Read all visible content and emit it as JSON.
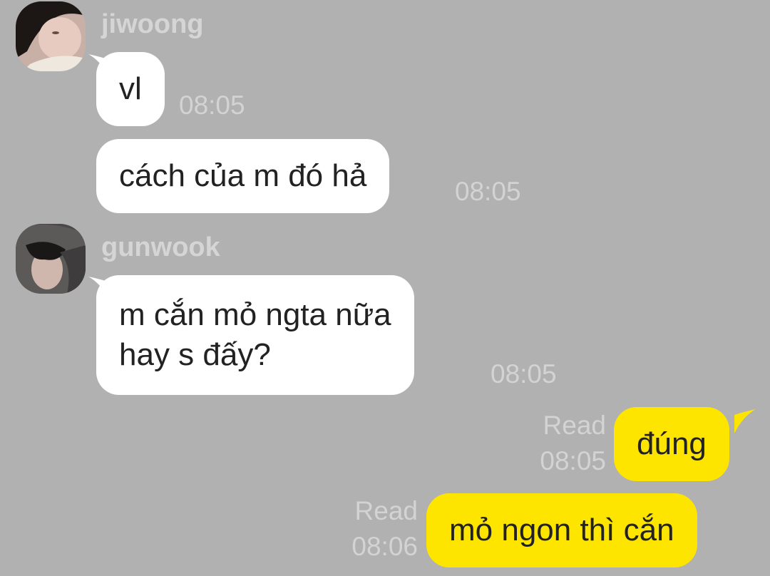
{
  "colors": {
    "background": "#b1b1b1",
    "incoming_bubble": "#ffffff",
    "outgoing_bubble": "#fee500",
    "meta_text": "#d3d3d3",
    "bubble_text": "#222222"
  },
  "messages": [
    {
      "sender": "jiwoong",
      "text": "vl",
      "time": "08:05"
    },
    {
      "text": "cách của m đó hả",
      "time": "08:05"
    },
    {
      "sender": "gunwook",
      "text_lines": [
        "m cắn mỏ ngta nữa",
        "hay s đấy?"
      ],
      "time": "08:05"
    },
    {
      "outgoing": true,
      "text": "đúng",
      "status": "Read",
      "time": "08:05"
    },
    {
      "outgoing": true,
      "text": "mỏ ngon thì cắn",
      "status": "Read",
      "time": "08:06"
    }
  ]
}
